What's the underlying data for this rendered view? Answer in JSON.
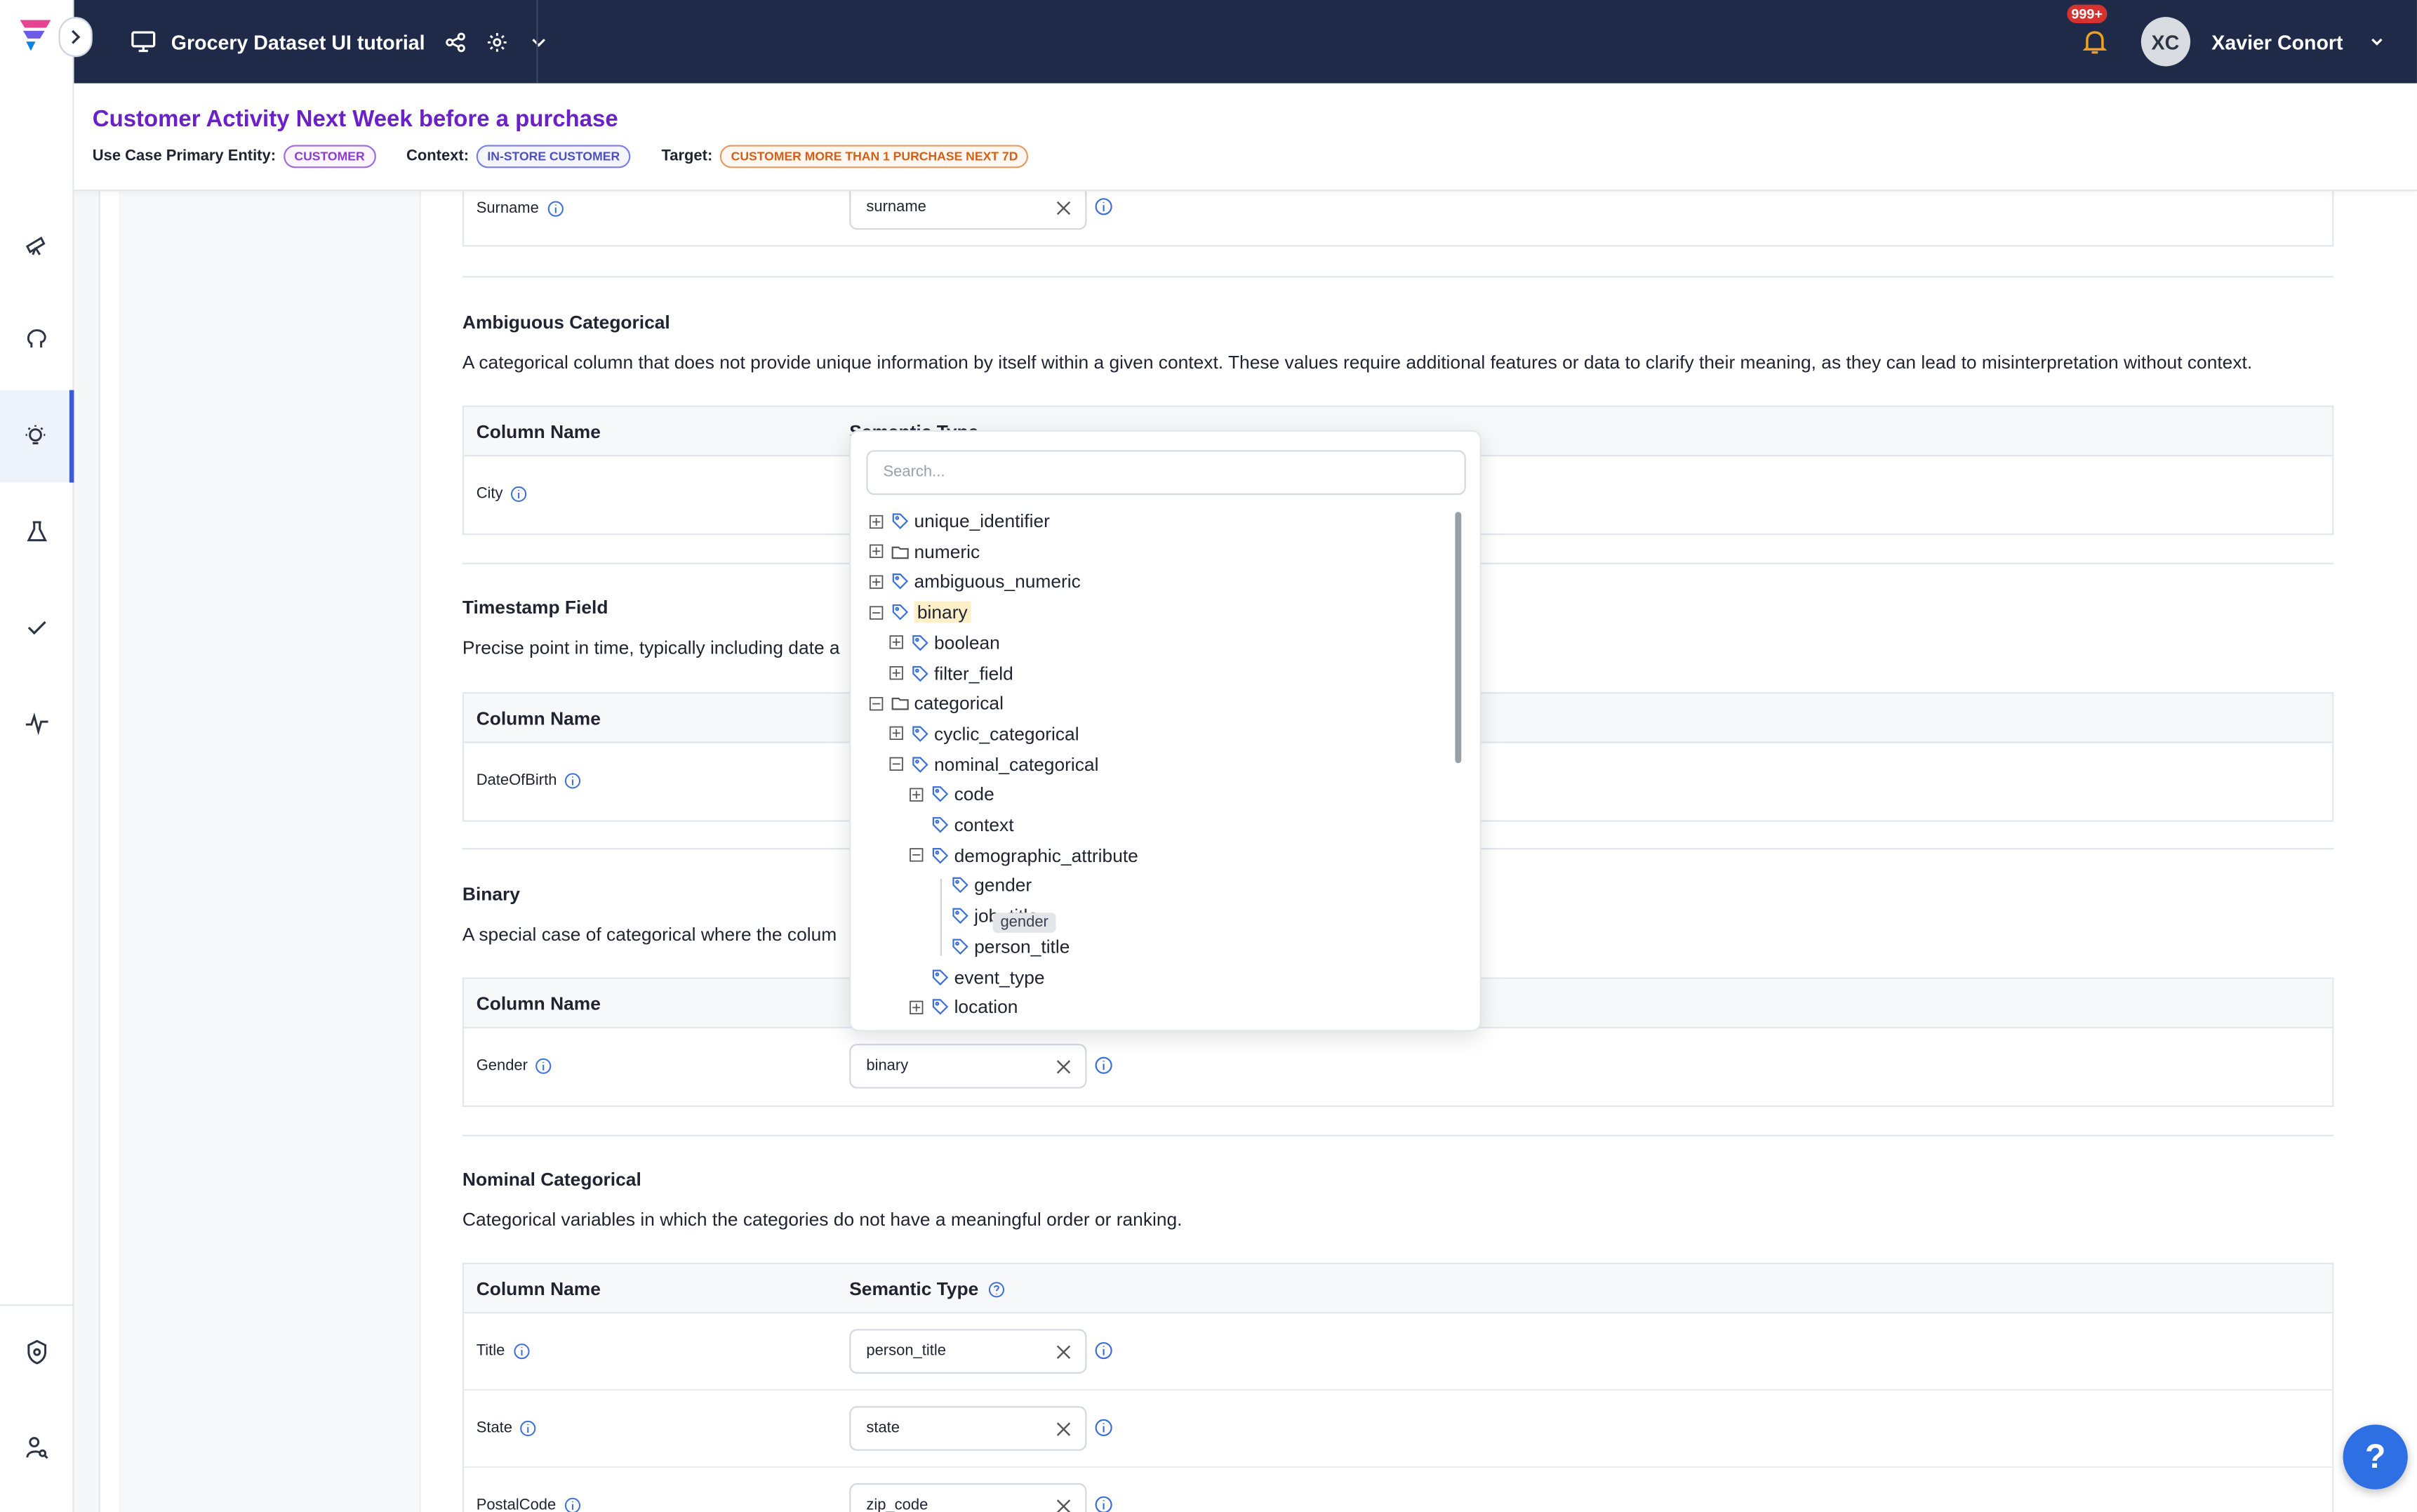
{
  "topbar": {
    "project_title": "Grocery Dataset UI tutorial",
    "notifications_badge": "999+",
    "avatar_initials": "XC",
    "user_name": "Xavier Conort"
  },
  "header": {
    "title": "Customer Activity Next Week before a purchase",
    "entity_label": "Use Case Primary Entity:",
    "entity_value": "CUSTOMER",
    "context_label": "Context:",
    "context_value": "IN-STORE CUSTOMER",
    "target_label": "Target:",
    "target_value": "CUSTOMER MORE THAN 1 PURCHASE NEXT 7D"
  },
  "table_headers": {
    "column_name": "Column Name",
    "semantic_type": "Semantic Type"
  },
  "surname_row": {
    "name": "Surname",
    "value": "surname"
  },
  "sections": {
    "ambiguous": {
      "title": "Ambiguous Categorical",
      "desc": "A categorical column that does not provide unique information by itself within a given context. These values require additional features or data to clarify their meaning, as they can lead to misinterpretation without context.",
      "row": "City"
    },
    "timestamp": {
      "title": "Timestamp Field",
      "desc": "Precise point in time, typically including date a",
      "row": "DateOfBirth"
    },
    "binary": {
      "title": "Binary",
      "desc": "A special case of categorical where the colum",
      "row": "Gender",
      "value": "binary"
    },
    "nominal": {
      "title": "Nominal Categorical",
      "desc": "Categorical variables in which the categories do not have a meaningful order or ranking.",
      "rows": [
        {
          "name": "Title",
          "value": "person_title"
        },
        {
          "name": "State",
          "value": "state"
        },
        {
          "name": "PostalCode",
          "value": "zip_code"
        }
      ]
    }
  },
  "dropdown": {
    "search_placeholder": "Search...",
    "tooltip": "gender",
    "nodes": [
      {
        "label": "unique_identifier",
        "icon": "tag-icon",
        "toggle": "plus"
      },
      {
        "label": "numeric",
        "icon": "folder-icon",
        "toggle": "plus"
      },
      {
        "label": "ambiguous_numeric",
        "icon": "tag-icon",
        "toggle": "plus"
      },
      {
        "label": "binary",
        "icon": "tag-icon",
        "toggle": "minus",
        "selected": true
      },
      {
        "label": "boolean",
        "icon": "tag-icon",
        "toggle": "plus"
      },
      {
        "label": "filter_field",
        "icon": "tag-icon",
        "toggle": "plus"
      },
      {
        "label": "categorical",
        "icon": "folder-icon",
        "toggle": "minus"
      },
      {
        "label": "cyclic_categorical",
        "icon": "tag-icon",
        "toggle": "plus"
      },
      {
        "label": "nominal_categorical",
        "icon": "tag-icon",
        "toggle": "minus"
      },
      {
        "label": "code",
        "icon": "tag-icon",
        "toggle": "plus"
      },
      {
        "label": "context",
        "icon": "tag-icon",
        "toggle": "none"
      },
      {
        "label": "demographic_attribute",
        "icon": "tag-icon",
        "toggle": "minus"
      },
      {
        "label": "gender",
        "icon": "tag-icon",
        "toggle": "none"
      },
      {
        "label": "job_title",
        "icon": "tag-icon",
        "toggle": "none"
      },
      {
        "label": "person_title",
        "icon": "tag-icon",
        "toggle": "none"
      },
      {
        "label": "event_type",
        "icon": "tag-icon",
        "toggle": "none"
      },
      {
        "label": "location",
        "icon": "tag-icon",
        "toggle": "plus"
      }
    ]
  },
  "help_label": "?",
  "colors": {
    "topbar": "#1e2a48",
    "title": "#6b21c8",
    "accent": "#3b5bdb",
    "help": "#2f6fe4"
  }
}
